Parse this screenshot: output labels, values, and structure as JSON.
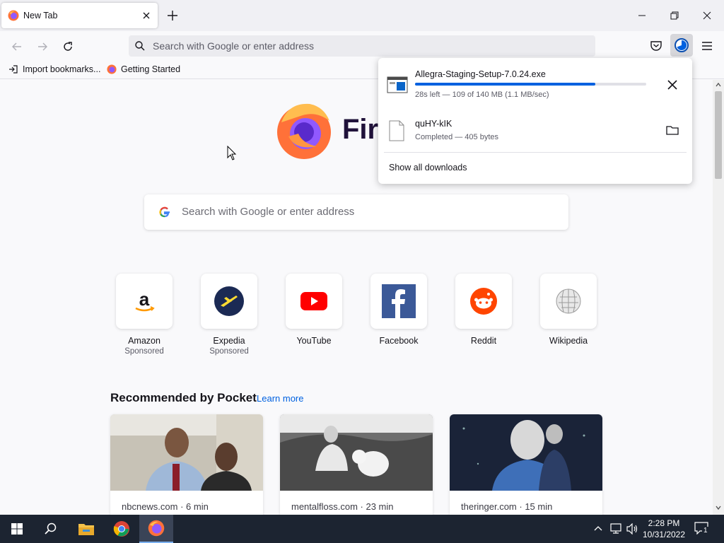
{
  "tab": {
    "title": "New Tab"
  },
  "navbar": {
    "url_placeholder": "Search with Google or enter address"
  },
  "bookmarks": [
    {
      "label": "Import bookmarks..."
    },
    {
      "label": "Getting Started"
    }
  ],
  "newtab": {
    "wordmark": "Fir",
    "search_placeholder": "Search with Google or enter address",
    "topsites": [
      {
        "name": "Amazon",
        "sponsored": "Sponsored",
        "icon": "amazon-icon"
      },
      {
        "name": "Expedia",
        "sponsored": "Sponsored",
        "icon": "expedia-icon"
      },
      {
        "name": "YouTube",
        "sponsored": "",
        "icon": "youtube-icon"
      },
      {
        "name": "Facebook",
        "sponsored": "",
        "icon": "facebook-icon"
      },
      {
        "name": "Reddit",
        "sponsored": "",
        "icon": "reddit-icon"
      },
      {
        "name": "Wikipedia",
        "sponsored": "",
        "icon": "wikipedia-icon"
      }
    ],
    "pocket": {
      "title": "Recommended by Pocket",
      "learn_more": "Learn more",
      "cards": [
        {
          "source": "nbcnews.com · 6 min"
        },
        {
          "source": "mentalfloss.com · 23 min"
        },
        {
          "source": "theringer.com · 15 min"
        }
      ]
    }
  },
  "downloads": {
    "items": [
      {
        "name": "Allegra-Staging-Setup-7.0.24.exe",
        "status": "28s left — 109 of 140 MB (1.1 MB/sec)",
        "progress": 0.78
      },
      {
        "name": "quHY-kIK",
        "status": "Completed — 405 bytes"
      }
    ],
    "show_all": "Show all downloads"
  },
  "taskbar": {
    "time": "2:28 PM",
    "date": "10/31/2022",
    "notifications": "1"
  },
  "colors": {
    "accent": "#0061e0",
    "taskbar": "#1c2431"
  }
}
